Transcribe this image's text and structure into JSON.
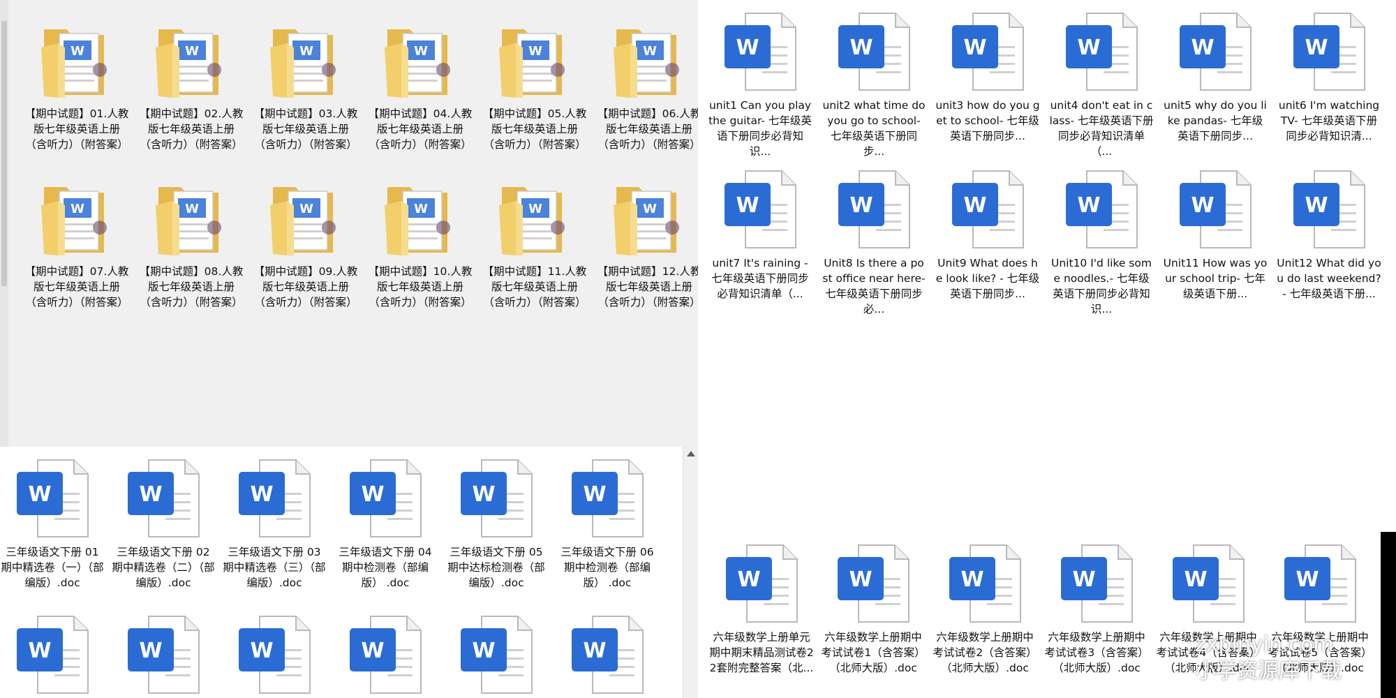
{
  "top_left_folders": [
    {
      "label": "【期中试题】01.人教版七年级英语上册（含听力）（附答案）"
    },
    {
      "label": "【期中试题】02.人教版七年级英语上册（含听力）（附答案）"
    },
    {
      "label": "【期中试题】03.人教版七年级英语上册（含听力）（附答案）"
    },
    {
      "label": "【期中试题】04.人教版七年级英语上册（含听力）（附答案）"
    },
    {
      "label": "【期中试题】05.人教版七年级英语上册（含听力）（附答案）"
    },
    {
      "label": "【期中试题】06.人教版七年级英语上册（含听力）（附答案）"
    },
    {
      "label": "【期中试题】07.人教版七年级英语上册（含听力）（附答案）"
    },
    {
      "label": "【期中试题】08.人教版七年级英语上册（含听力）（附答案）"
    },
    {
      "label": "【期中试题】09.人教版七年级英语上册（含听力）（附答案）"
    },
    {
      "label": "【期中试题】10.人教版七年级英语上册（含听力）（附答案）"
    },
    {
      "label": "【期中试题】11.人教版七年级英语上册（含听力）（附答案）"
    },
    {
      "label": "【期中试题】12.人教版七年级英语上册（含听力）（附答案）"
    }
  ],
  "top_right_docs": [
    {
      "label": "unit1 Can you play the guitar- 七年级英语下册同步必背知识..."
    },
    {
      "label": "unit2 what time do you go to school- 七年级英语下册同步..."
    },
    {
      "label": "unit3 how do you get to school- 七年级英语下册同步..."
    },
    {
      "label": "unit4 don't eat in class- 七年级英语下册同步必背知识清单（..."
    },
    {
      "label": "unit5 why do you like pandas- 七年级英语下册同步..."
    },
    {
      "label": "unit6 I'm watching TV- 七年级英语下册同步必背知识清..."
    },
    {
      "label": "unit7 It's raining - 七年级英语下册同步必背知识清单（..."
    },
    {
      "label": "Unit8 Is there a post office near here- 七年级英语下册同步必..."
    },
    {
      "label": "Unit9 What does he look like? - 七年级英语下册同步..."
    },
    {
      "label": "Unit10 I'd like some noodles.- 七年级英语下册同步必背知识..."
    },
    {
      "label": "Unit11 How was your school trip- 七年级英语下册..."
    },
    {
      "label": "Unit12 What did you do last weekend? - 七年级英语下册..."
    }
  ],
  "bottom_left_docs": [
    {
      "label": "三年级语文下册 01 期中精选卷（一）（部编版）.doc"
    },
    {
      "label": "三年级语文下册 02 期中精选卷（二）（部编版）.doc"
    },
    {
      "label": "三年级语文下册 03 期中精选卷（三）（部编版）.doc"
    },
    {
      "label": "三年级语文下册 04 期中检测卷（部编版） .doc"
    },
    {
      "label": "三年级语文下册 05 期中达标检测卷（部编版）.doc"
    },
    {
      "label": "三年级语文下册 06 期中检测卷（部编版） .doc"
    },
    {
      "label": ""
    },
    {
      "label": ""
    },
    {
      "label": ""
    },
    {
      "label": ""
    },
    {
      "label": ""
    },
    {
      "label": ""
    }
  ],
  "bottom_right_docs": [
    {
      "label": "六年级数学上册单元期中期末精品测试卷22套附完整答案（北..."
    },
    {
      "label": "六年级数学上册期中考试试卷1（含答案）（北师大版）.doc"
    },
    {
      "label": "六年级数学上册期中考试试卷2（含答案）（北师大版）.doc"
    },
    {
      "label": "六年级数学上册期中考试试卷3（含答案）（北师大版）.doc"
    },
    {
      "label": "六年级数学上册期中考试试卷4（含答案）（北师大版）.doc"
    },
    {
      "label": "六年级数学上册期中考试试卷5（含答案）（北师大版）.doc"
    }
  ],
  "word_letter": "W",
  "watermark": {
    "line1": "zxpinyin.com",
    "line2": "小学资源库下载"
  },
  "colors": {
    "word_blue": "#2b6cd4",
    "folder_yellow": "#f2cf6b"
  }
}
